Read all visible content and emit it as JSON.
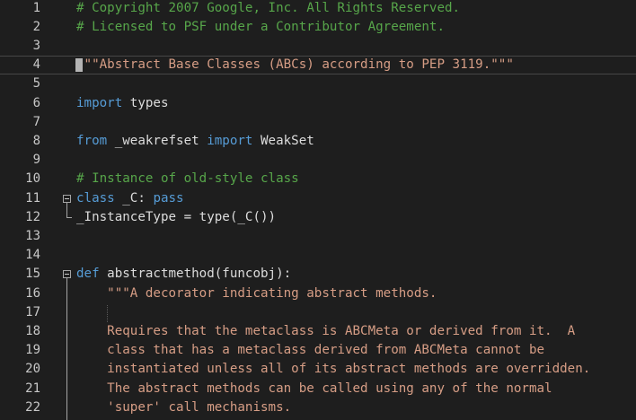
{
  "editor": {
    "colors": {
      "background": "#1e1e1e",
      "comment": "#57a64a",
      "keyword": "#569cd6",
      "string": "#d69d85",
      "text": "#dcdcdc",
      "line_number": "#c8c8c8"
    },
    "lines": [
      {
        "num": "1",
        "segments": [
          {
            "t": "# Copyright 2007 Google, Inc. All Rights Reserved.",
            "c": "cmt"
          }
        ]
      },
      {
        "num": "2",
        "segments": [
          {
            "t": "# Licensed to PSF under a Contributor Agreement.",
            "c": "cmt"
          }
        ]
      },
      {
        "num": "3",
        "segments": []
      },
      {
        "num": "4",
        "segments": [
          {
            "t": "\"\"\"Abstract Base Classes (ABCs) according to PEP 3119.\"\"\"",
            "c": "str"
          }
        ]
      },
      {
        "num": "5",
        "segments": []
      },
      {
        "num": "6",
        "segments": [
          {
            "t": "import",
            "c": "kw"
          },
          {
            "t": " types",
            "c": "plain"
          }
        ]
      },
      {
        "num": "7",
        "segments": []
      },
      {
        "num": "8",
        "segments": [
          {
            "t": "from",
            "c": "kw"
          },
          {
            "t": " _weakrefset ",
            "c": "plain"
          },
          {
            "t": "import",
            "c": "kw"
          },
          {
            "t": " WeakSet",
            "c": "plain"
          }
        ]
      },
      {
        "num": "9",
        "segments": []
      },
      {
        "num": "10",
        "segments": [
          {
            "t": "# Instance of old-style class",
            "c": "cmt"
          }
        ]
      },
      {
        "num": "11",
        "segments": [
          {
            "t": "class",
            "c": "kw"
          },
          {
            "t": " _C: ",
            "c": "plain"
          },
          {
            "t": "pass",
            "c": "kw"
          }
        ]
      },
      {
        "num": "12",
        "segments": [
          {
            "t": "_InstanceType = type(_C())",
            "c": "plain"
          }
        ]
      },
      {
        "num": "13",
        "segments": []
      },
      {
        "num": "14",
        "segments": []
      },
      {
        "num": "15",
        "segments": [
          {
            "t": "def",
            "c": "kw"
          },
          {
            "t": " abstractmethod(funcobj):",
            "c": "plain"
          }
        ]
      },
      {
        "num": "16",
        "segments": [
          {
            "t": "    \"\"\"A decorator indicating abstract methods.",
            "c": "str"
          }
        ]
      },
      {
        "num": "17",
        "segments": []
      },
      {
        "num": "18",
        "segments": [
          {
            "t": "    Requires that the metaclass is ABCMeta or derived from it.  A",
            "c": "str"
          }
        ]
      },
      {
        "num": "19",
        "segments": [
          {
            "t": "    class that has a metaclass derived from ABCMeta cannot be",
            "c": "str"
          }
        ]
      },
      {
        "num": "20",
        "segments": [
          {
            "t": "    instantiated unless all of its abstract methods are overridden.",
            "c": "str"
          }
        ]
      },
      {
        "num": "21",
        "segments": [
          {
            "t": "    The abstract methods can be called using any of the normal",
            "c": "str"
          }
        ]
      },
      {
        "num": "22",
        "segments": [
          {
            "t": "    'super' call mechanisms.",
            "c": "str"
          }
        ]
      }
    ]
  }
}
